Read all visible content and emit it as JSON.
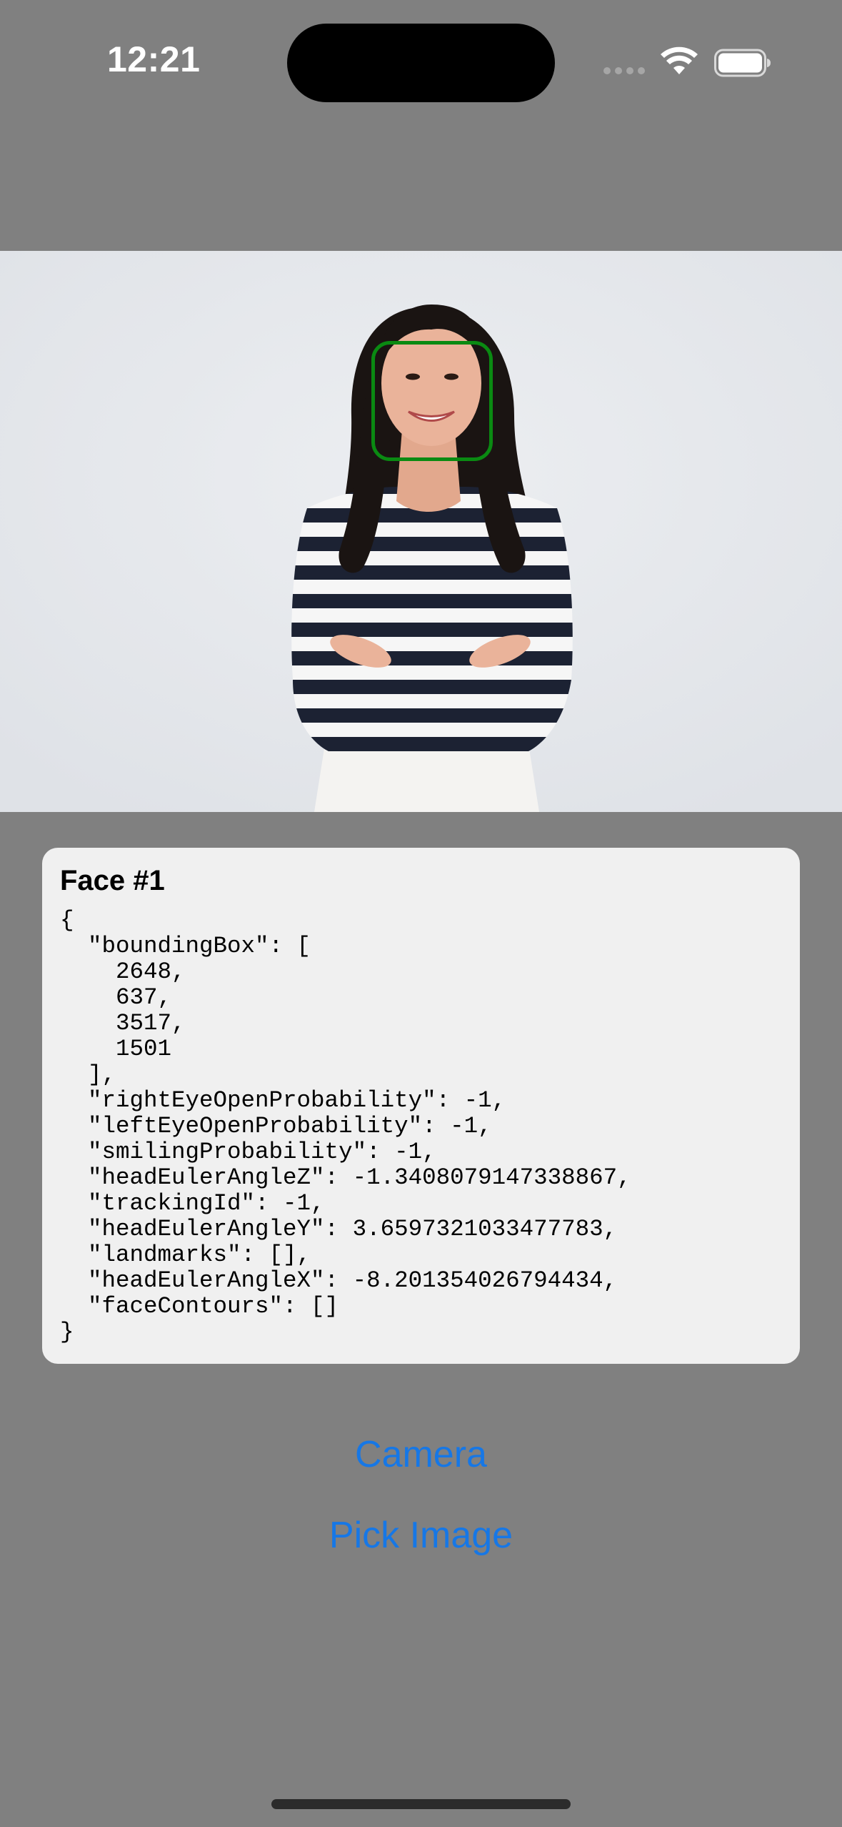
{
  "status_bar": {
    "time": "12:21",
    "wifi_icon": "wifi-icon",
    "battery_icon": "battery-icon"
  },
  "image": {
    "description_icon": "photo-of-smiling-woman-in-striped-shirt",
    "face_box_color": "#0a8a12"
  },
  "face_card": {
    "title": "Face #1",
    "json_text": "{\n  \"boundingBox\": [\n    2648,\n    637,\n    3517,\n    1501\n  ],\n  \"rightEyeOpenProbability\": -1,\n  \"leftEyeOpenProbability\": -1,\n  \"smilingProbability\": -1,\n  \"headEulerAngleZ\": -1.3408079147338867,\n  \"trackingId\": -1,\n  \"headEulerAngleY\": 3.6597321033477783,\n  \"landmarks\": [],\n  \"headEulerAngleX\": -8.201354026794434,\n  \"faceContours\": []\n}"
  },
  "buttons": {
    "camera_label": "Camera",
    "pick_image_label": "Pick Image"
  },
  "colors": {
    "background": "#808080",
    "accent": "#1677e6",
    "card_bg": "#f0f0f0"
  }
}
